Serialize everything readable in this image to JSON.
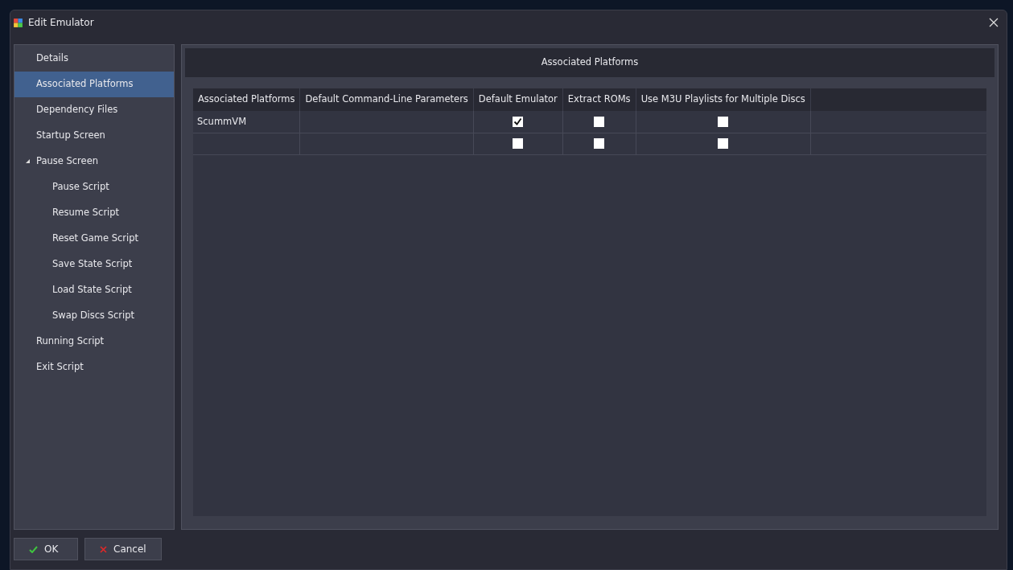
{
  "window": {
    "title": "Edit Emulator"
  },
  "sidebar": {
    "items": [
      {
        "label": "Details",
        "selected": false
      },
      {
        "label": "Associated Platforms",
        "selected": true
      },
      {
        "label": "Dependency Files",
        "selected": false
      },
      {
        "label": "Startup Screen",
        "selected": false
      },
      {
        "label": "Pause Screen",
        "selected": false,
        "expanded": true,
        "children": [
          {
            "label": "Pause Script",
            "selected": false
          },
          {
            "label": "Resume Script",
            "selected": false
          },
          {
            "label": "Reset Game Script",
            "selected": false
          },
          {
            "label": "Save State Script",
            "selected": false
          },
          {
            "label": "Load State Script",
            "selected": false
          },
          {
            "label": "Swap Discs Script",
            "selected": false
          }
        ]
      },
      {
        "label": "Running Script",
        "selected": false
      },
      {
        "label": "Exit Script",
        "selected": false
      }
    ]
  },
  "panel": {
    "title": "Associated Platforms",
    "table": {
      "columns": [
        "Associated Platforms",
        "Default Command-Line Parameters",
        "Default Emulator",
        "Extract ROMs",
        "Use M3U Playlists for Multiple Discs"
      ],
      "rows": [
        {
          "platform": "ScummVM",
          "default_emulator": true,
          "extract_roms": false,
          "use_m3u": false
        },
        {
          "default_emulator": false,
          "extract_roms": false,
          "use_m3u": false
        }
      ]
    }
  },
  "buttons": [
    {
      "label": "OK",
      "kind": "ok"
    },
    {
      "label": "Cancel",
      "kind": "cancel"
    }
  ]
}
